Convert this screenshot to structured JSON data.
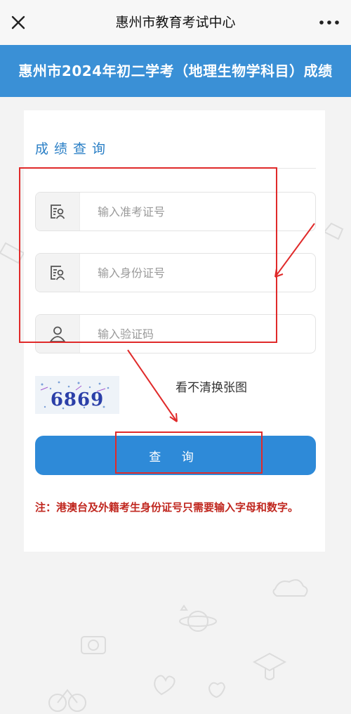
{
  "nav": {
    "title": "惠州市教育考试中心",
    "close_icon": "close-icon",
    "more_icon": "more-icon"
  },
  "banner": {
    "text": "惠州市2024年初二学考（地理生物学科目）成绩"
  },
  "form": {
    "title": "成绩查询",
    "exam_no": {
      "placeholder": "输入准考证号",
      "value": "",
      "icon": "id-card-icon"
    },
    "id_no": {
      "placeholder": "输入身份证号",
      "value": "",
      "icon": "id-card-icon"
    },
    "captcha_input": {
      "placeholder": "输入验证码",
      "value": "",
      "icon": "user-icon"
    },
    "captcha_text": "6869",
    "captcha_refresh": "看不清换张图",
    "submit_label": "查 询",
    "note": "注：港澳台及外籍考生身份证号只需要输入字母和数字。"
  },
  "colors": {
    "banner": "#3a90d6",
    "button": "#2e8ad8",
    "title": "#2a7fc6",
    "note": "#c0271f",
    "annotation": "#e02a2a"
  }
}
